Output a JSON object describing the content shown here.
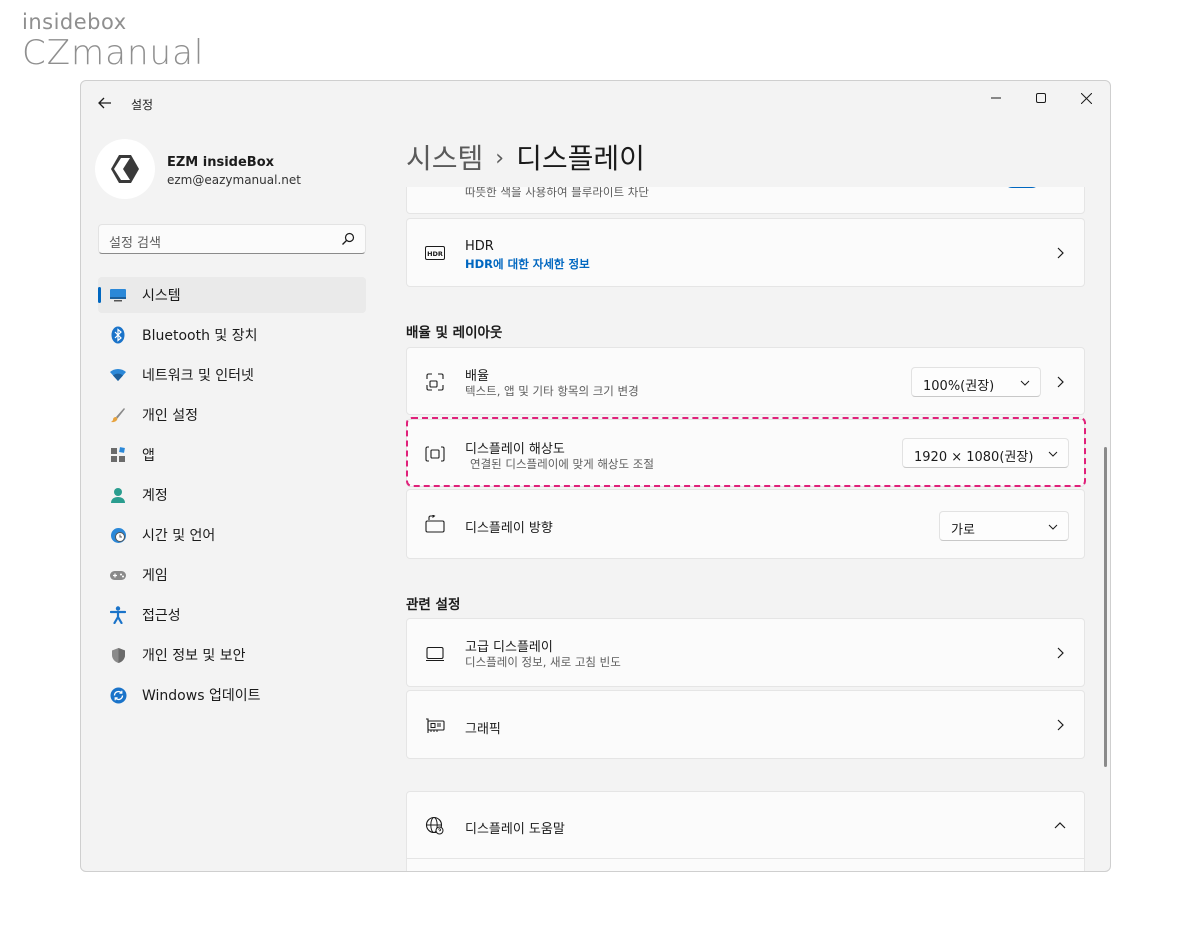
{
  "watermark": {
    "top": "insidebox",
    "bottom": "CZmanual"
  },
  "window": {
    "app_title": "설정"
  },
  "profile": {
    "name": "EZM insideBox",
    "email": "ezm@eazymanual.net"
  },
  "search": {
    "placeholder": "설정 검색"
  },
  "sidebar": {
    "items": [
      {
        "label": "시스템",
        "icon": "display-system-icon",
        "active": true
      },
      {
        "label": "Bluetooth 및 장치",
        "icon": "bluetooth-icon"
      },
      {
        "label": "네트워크 및 인터넷",
        "icon": "wifi-icon"
      },
      {
        "label": "개인 설정",
        "icon": "brush-icon"
      },
      {
        "label": "앱",
        "icon": "apps-icon"
      },
      {
        "label": "계정",
        "icon": "person-icon"
      },
      {
        "label": "시간 및 언어",
        "icon": "globe-clock-icon"
      },
      {
        "label": "게임",
        "icon": "gamepad-icon"
      },
      {
        "label": "접근성",
        "icon": "accessibility-icon"
      },
      {
        "label": "개인 정보 및 보안",
        "icon": "shield-icon"
      },
      {
        "label": "Windows 업데이트",
        "icon": "update-icon"
      }
    ]
  },
  "breadcrumb": {
    "parent": "시스템",
    "separator": "›",
    "current": "디스플레이"
  },
  "content": {
    "night_light_sub": "따뜻한 색을 사용하여 블루라이트 차단",
    "hdr": {
      "title": "HDR",
      "link": "HDR에 대한 자세한 정보"
    },
    "scale_section": "배율 및 레이아웃",
    "scale": {
      "title": "배율",
      "sub": "텍스트, 앱 및 기타 항목의 크기 변경",
      "value": "100%(권장)"
    },
    "resolution": {
      "title": "디스플레이 해상도",
      "sub": "연결된 디스플레이에 맞게 해상도 조절",
      "value": "1920 × 1080(권장)"
    },
    "orientation": {
      "title": "디스플레이 방향",
      "value": "가로"
    },
    "related_section": "관련 설정",
    "advanced": {
      "title": "고급 디스플레이",
      "sub": "디스플레이 정보, 새로 고침 빈도"
    },
    "graphics": {
      "title": "그래픽"
    },
    "help": {
      "title": "디스플레이 도움말"
    }
  },
  "colors": {
    "accent": "#0067c0",
    "highlight": "#e0207a",
    "background": "#f3f3f3",
    "card": "#fbfbfb"
  }
}
